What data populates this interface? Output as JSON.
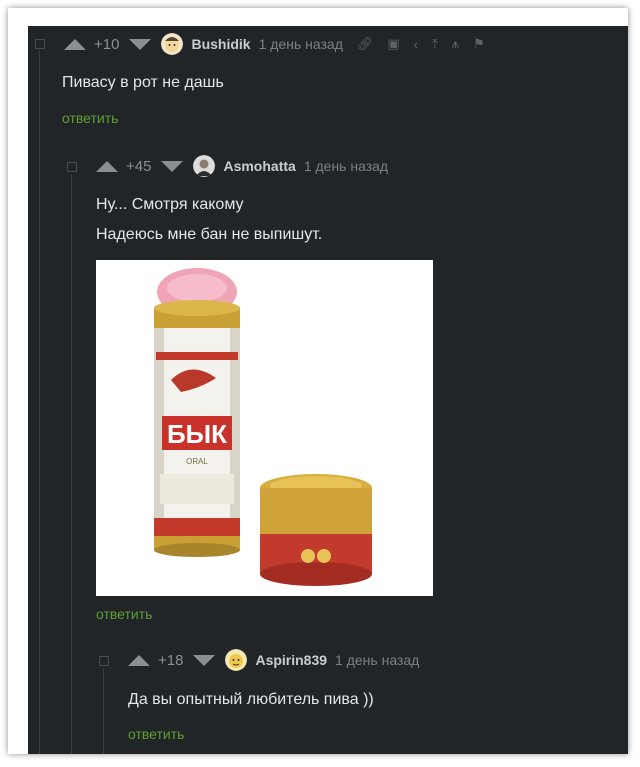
{
  "comments": [
    {
      "rating": "+10",
      "username": "Bushidik",
      "time": "1 день назад",
      "lines": [
        "Пивасу в рот не дашь"
      ],
      "reply": "ответить"
    },
    {
      "rating": "+45",
      "username": "Asmohatta",
      "time": "1 день назад",
      "lines": [
        "Ну... Смотря какому",
        "Надеюсь мне бан не выпишут."
      ],
      "image": {
        "can_text": "БЫК",
        "can_subtext": "ORAL"
      },
      "reply": "ответить"
    },
    {
      "rating": "+18",
      "username": "Aspirin839",
      "time": "1 день назад",
      "lines": [
        "Да вы опытный любитель пива ))"
      ],
      "reply": "ответить"
    }
  ],
  "icons": [
    "link-icon",
    "save-icon",
    "share-icon",
    "pin-icon",
    "branch-icon",
    "flag-icon"
  ],
  "colors": {
    "background": "#222528",
    "reply": "#5da130",
    "text": "#e4e6e8"
  }
}
